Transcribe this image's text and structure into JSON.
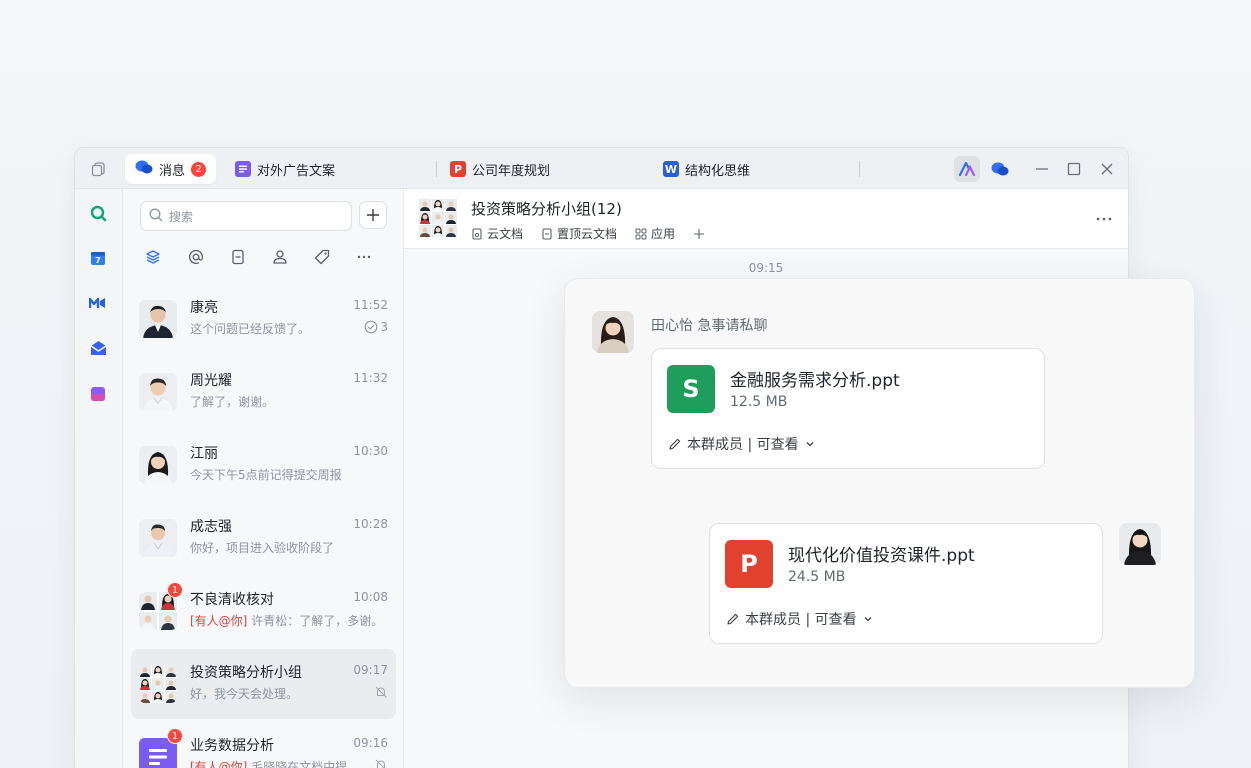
{
  "tabs": [
    {
      "label": "消息",
      "badge": "2"
    },
    {
      "label": "对外广告文案",
      "icon": "doc-icon"
    },
    {
      "label": "公司年度规划",
      "icon": "ppt-icon",
      "icon_letter": "P"
    },
    {
      "label": "结构化思维",
      "icon": "word-icon",
      "icon_letter": "W"
    }
  ],
  "search": {
    "placeholder": "搜索"
  },
  "chats": [
    {
      "name": "康亮",
      "time": "11:52",
      "preview": "这个问题已经反馈了。",
      "meta": "3"
    },
    {
      "name": "周光耀",
      "time": "11:32",
      "preview": "了解了，谢谢。"
    },
    {
      "name": "江丽",
      "time": "10:30",
      "preview": "今天下午5点前记得提交周报"
    },
    {
      "name": "成志强",
      "time": "10:28",
      "preview": "你好，项目进入验收阶段了"
    },
    {
      "name": "不良清收核对",
      "time": "10:08",
      "mention": "[有人@你]",
      "preview": " 许青松：了解了，多谢。",
      "unread": "1"
    },
    {
      "name": "投资策略分析小组",
      "time": "09:17",
      "preview": "好，我今天会处理。"
    },
    {
      "name": "业务数据分析",
      "time": "09:16",
      "mention": "[有人@你]",
      "preview": " 毛晓晓在文档中提...",
      "unread": "1"
    }
  ],
  "group": {
    "title": "投资策略分析小组(12)",
    "tools": [
      "云文档",
      "置顶云文档",
      "应用"
    ]
  },
  "timestamp": "09:15",
  "message": {
    "sender": "田心怡",
    "text": "急事请私聊"
  },
  "files": [
    {
      "name": "金融服务需求分析.ppt",
      "size": "12.5 MB",
      "perm": "本群成员 | 可查看",
      "icon_letter": "S"
    },
    {
      "name": "现代化价值投资课件.ppt",
      "size": "24.5 MB",
      "perm": "本群成员 | 可查看",
      "icon_letter": "P"
    }
  ],
  "colors": {
    "sheet": "#1e9e5a",
    "ppt": "#e2412f",
    "word": "#2b5fd9",
    "doc": "#7b5cf0",
    "accent": "#3370ff"
  }
}
